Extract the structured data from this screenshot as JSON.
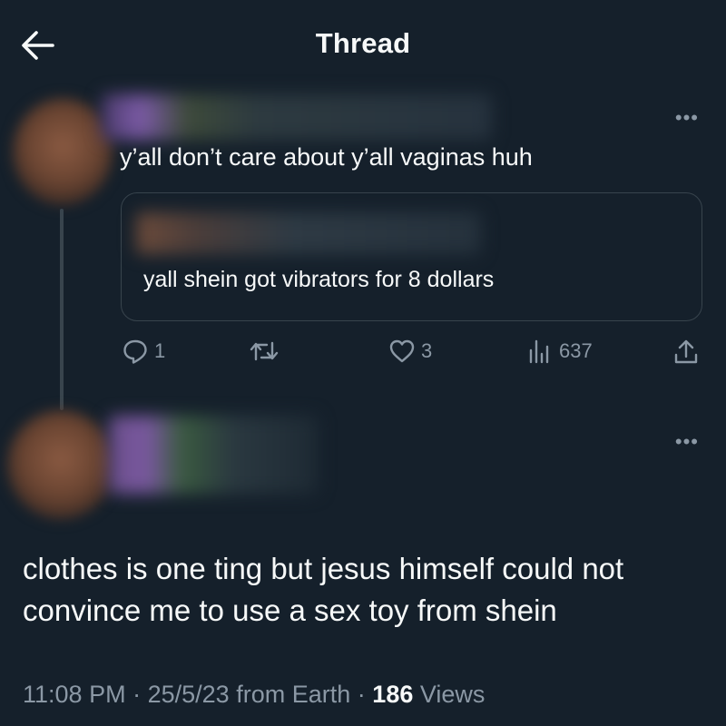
{
  "header": {
    "title": "Thread",
    "back_icon": "arrow-left-icon"
  },
  "parent_tweet": {
    "text": "y’all don’t care about y’all vaginas huh",
    "quote": {
      "text": "yall shein got vibrators for 8 dollars"
    },
    "actions": {
      "reply_count": "1",
      "retweet_count": "",
      "like_count": "3",
      "views_count": "637"
    }
  },
  "main_tweet": {
    "text": "clothes is one ting but jesus himself could not convince me to use a sex toy from shein",
    "time": "11:08 PM",
    "separator": "·",
    "date": "25/5/23",
    "from": "from Earth",
    "views_count": "186",
    "views_label": "Views"
  },
  "colors": {
    "background": "#15202b",
    "text": "#f7f9f9",
    "secondary": "#8b98a5",
    "border": "#38444d"
  }
}
